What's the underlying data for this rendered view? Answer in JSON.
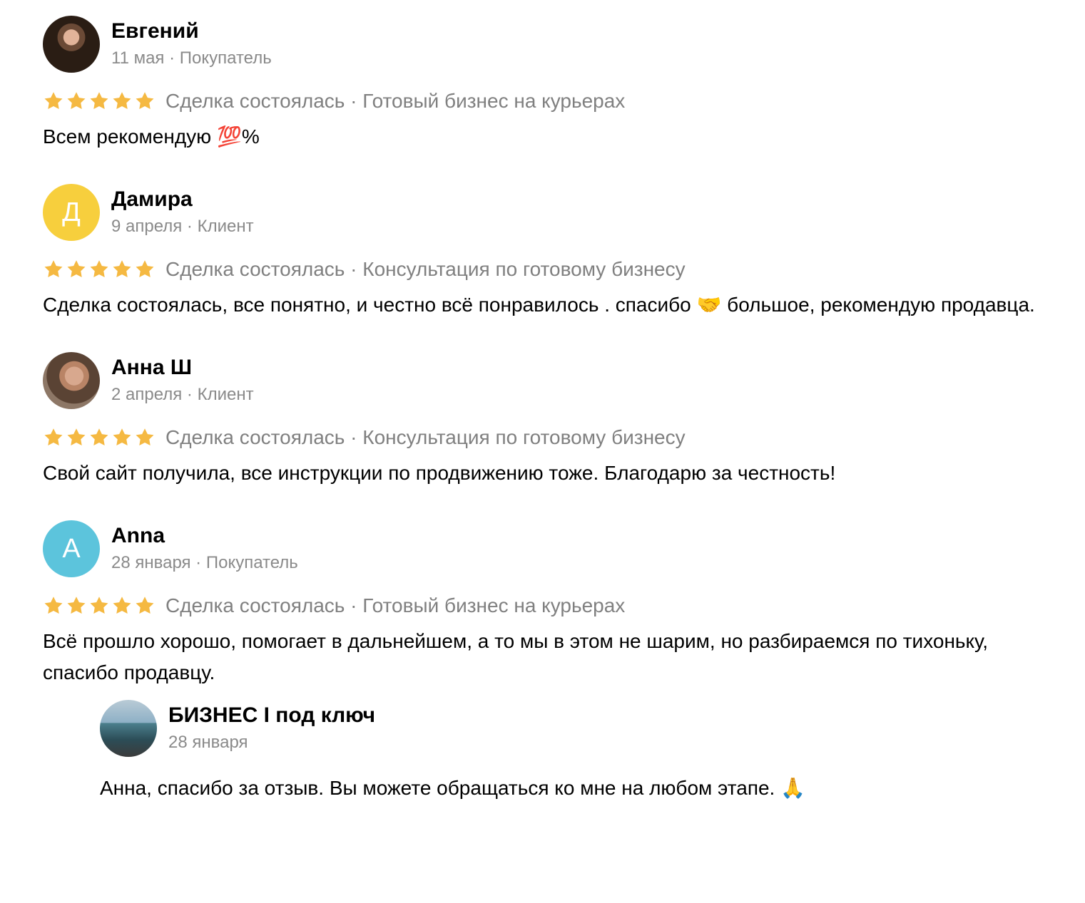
{
  "colors": {
    "star": "#f5b942",
    "meta": "#8a8a8a",
    "avatar_damira": "#f7cf3d",
    "avatar_anna": "#5cc4dc"
  },
  "reviews": [
    {
      "name": "Евгений",
      "date": "11 мая",
      "role": "Покупатель",
      "rating": 5,
      "deal_status": "Сделка состоялась",
      "deal_subject": "Готовый бизнес на курьерах",
      "text": "Всем рекомендую 💯%",
      "avatar_icon": "photo-avatar"
    },
    {
      "name": "Дамира",
      "date": "9 апреля",
      "role": "Клиент",
      "rating": 5,
      "deal_status": "Сделка состоялась",
      "deal_subject": "Консультация по готовому бизнесу",
      "text": "Сделка состоялась, все понятно, и честно всё понравилось . спасибо 🤝 большое, рекомендую продавца.",
      "avatar_letter": "Д"
    },
    {
      "name": "Анна Ш",
      "date": "2 апреля",
      "role": "Клиент",
      "rating": 5,
      "deal_status": "Сделка состоялась",
      "deal_subject": "Консультация по готовому бизнесу",
      "text": "Свой сайт получила, все инструкции по продвижению тоже. Благодарю за честность!",
      "avatar_icon": "photo-avatar"
    },
    {
      "name": "Anna",
      "date": "28 января",
      "role": "Покупатель",
      "rating": 5,
      "deal_status": "Сделка состоялась",
      "deal_subject": "Готовый бизнес на курьерах",
      "text": "Всё прошло хорошо, помогает в дальнейшем, а то мы в этом не шарим, но разбираемся по тихоньку, спасибо продавцу.",
      "avatar_letter": "A",
      "reply": {
        "name": "БИЗНЕС I под ключ",
        "date": "28 января",
        "text": "Анна, спасибо за отзыв. Вы можете обращаться ко мне на любом этапе. 🙏",
        "avatar_icon": "photo-avatar"
      }
    }
  ],
  "separator": " · "
}
